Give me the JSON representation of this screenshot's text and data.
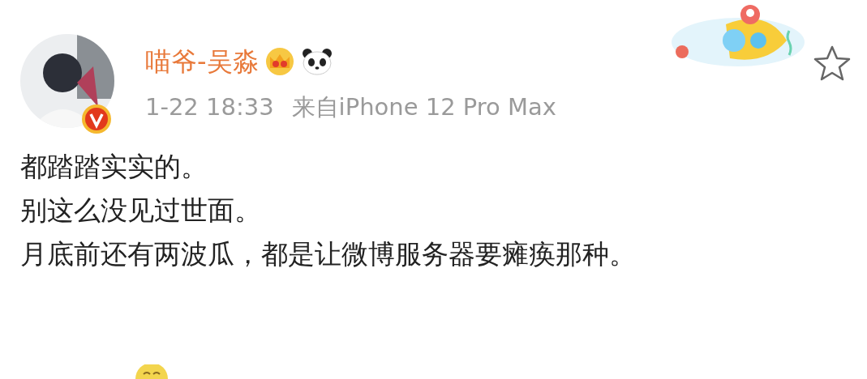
{
  "post": {
    "author": "喵爷-吴淼",
    "verified": true,
    "time": "1-22 18:33",
    "source": "来自iPhone 12 Pro Max",
    "favorited": false,
    "lines": [
      "都踏踏实实的。",
      "别这么没见过世面。",
      "月底前还有两波瓜，都是让微博服务器要瘫痪那种。"
    ]
  }
}
